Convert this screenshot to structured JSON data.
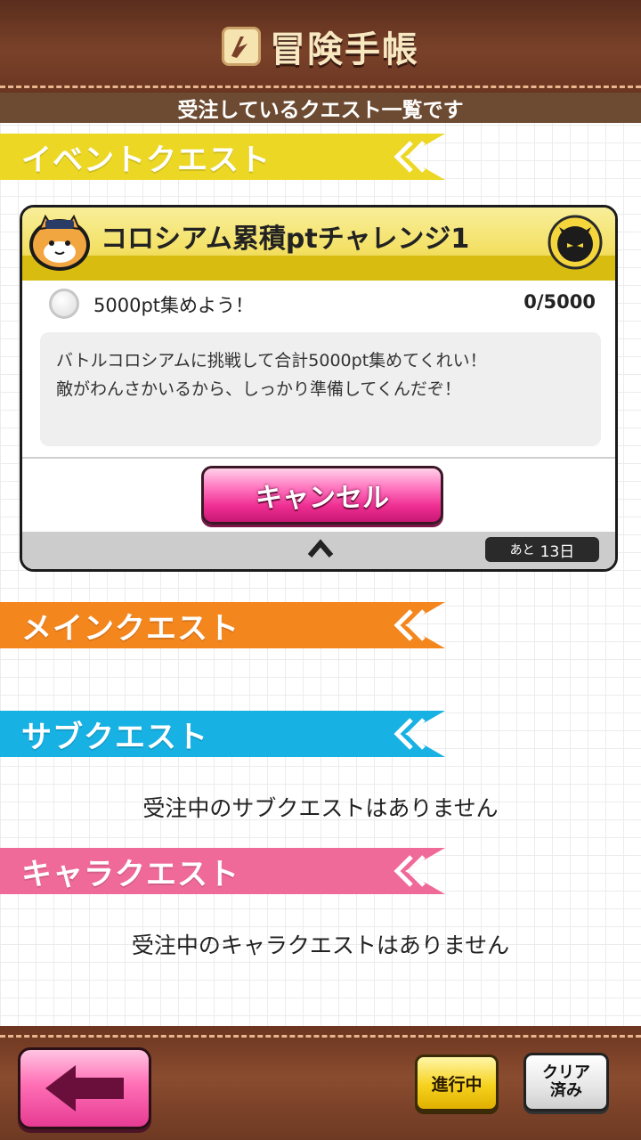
{
  "header": {
    "title": "冒険手帳",
    "subtitle": "受注しているクエスト一覧です"
  },
  "sections": {
    "event": {
      "label": "イベントクエスト",
      "color": "#ecd824"
    },
    "main": {
      "label": "メインクエスト",
      "color": "#f4861e"
    },
    "sub": {
      "label": "サブクエスト",
      "color": "#17b1e3",
      "empty_message": "受注中のサブクエストはありません"
    },
    "chara": {
      "label": "キャラクエスト",
      "color": "#ef6a98",
      "empty_message": "受注中のキャラクエストはありません"
    }
  },
  "event_quest": {
    "title": "コロシアム累積ptチャレンジ1",
    "goal_label": "5000pt集めよう！",
    "goal_progress": "0/5000",
    "description": [
      "バトルコロシアムに挑戦して合計5000pt集めてくれい！",
      "敵がわんさかいるから、しっかり準備してくんだぞ！"
    ],
    "cancel_label": "キャンセル",
    "days_left_prefix": "あと",
    "days_left_value": "13日",
    "icons": {
      "avatar": "cat-character-avatar-icon",
      "boss": "demon-boss-icon",
      "collapse": "chevron-up-icon",
      "goal": "unchecked-circle-icon"
    }
  },
  "footer": {
    "back_icon": "left-arrow-icon",
    "in_progress_label": "進行中",
    "cleared_label": "クリア\n済み"
  }
}
